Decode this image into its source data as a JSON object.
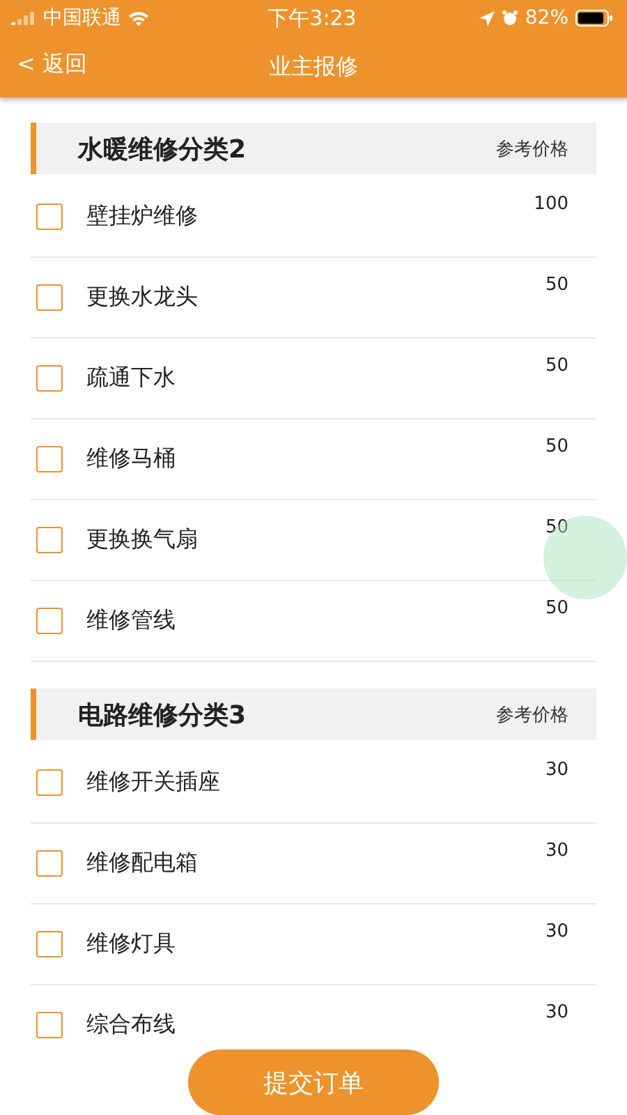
{
  "status_bar": {
    "carrier": "中国联通",
    "time": "下午3:23",
    "battery": "82%"
  },
  "nav": {
    "back": "< 返回",
    "title": "业主报修"
  },
  "sections": [
    {
      "title": "水暖维修分类2",
      "price_header": "参考价格",
      "items": [
        {
          "name": "壁挂炉维修",
          "price": "100",
          "checked": false
        },
        {
          "name": "更换水龙头",
          "price": "50",
          "checked": false
        },
        {
          "name": "疏通下水",
          "price": "50",
          "checked": false
        },
        {
          "name": "维修马桶",
          "price": "50",
          "checked": false
        },
        {
          "name": "更换换气扇",
          "price": "50",
          "checked": false
        },
        {
          "name": "维修管线",
          "price": "50",
          "checked": false
        }
      ]
    },
    {
      "title": "电路维修分类3",
      "price_header": "参考价格",
      "items": [
        {
          "name": "维修开关插座",
          "price": "30",
          "checked": false
        },
        {
          "name": "维修配电箱",
          "price": "30",
          "checked": false
        },
        {
          "name": "维修灯具",
          "price": "30",
          "checked": false
        },
        {
          "name": "综合布线",
          "price": "30",
          "checked": false
        }
      ]
    }
  ],
  "submit": "提交订单"
}
